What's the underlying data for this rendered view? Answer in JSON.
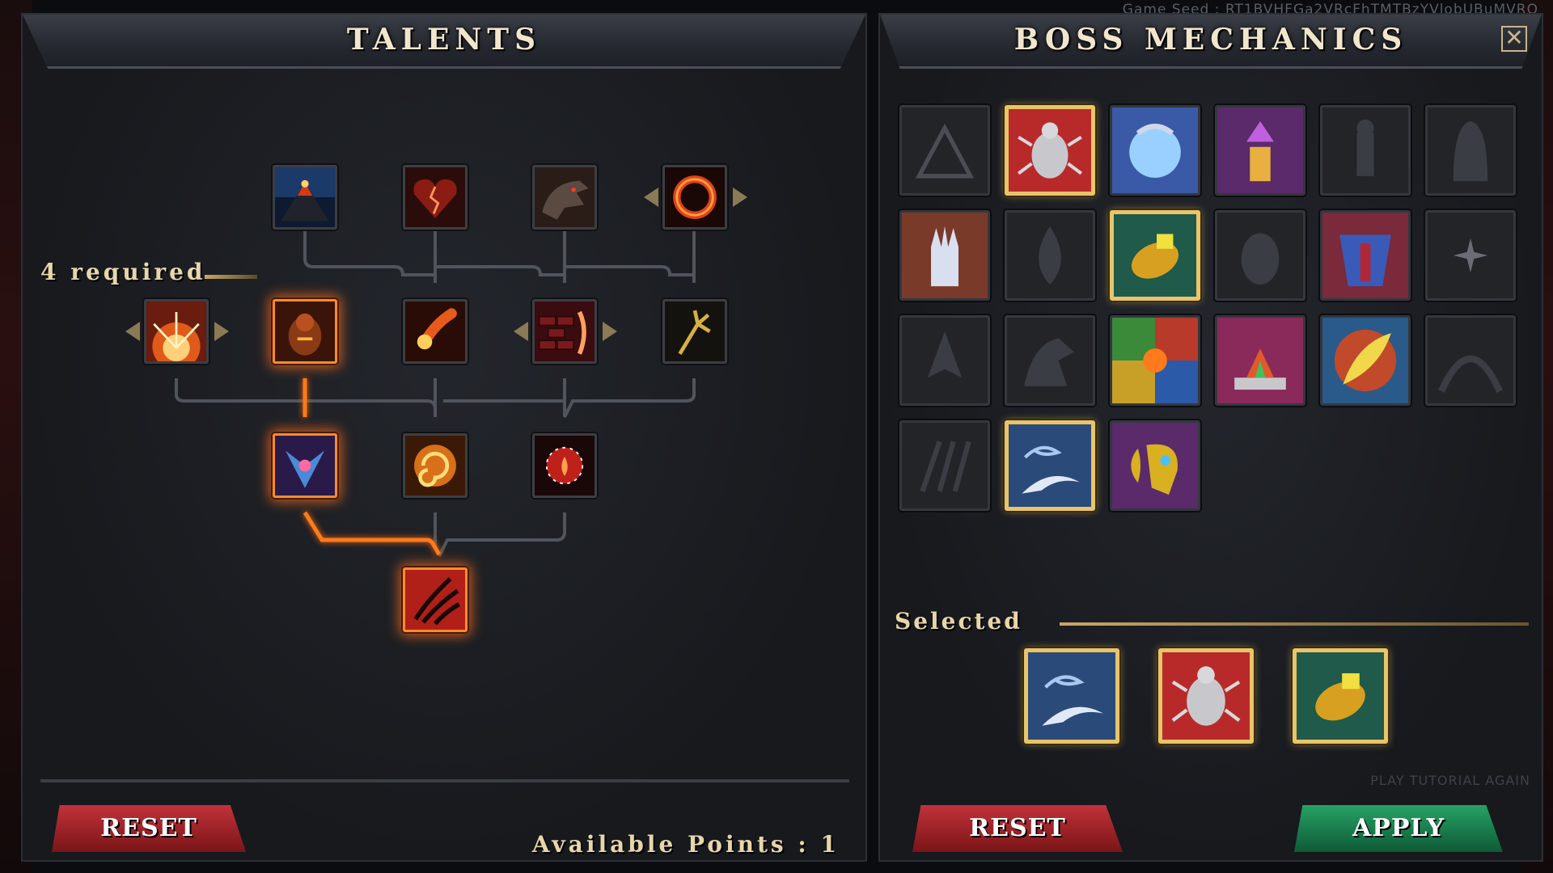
{
  "seed_text": "Game Seed : RT1BVHFGa2VRcFhTMTBzYVlobUBuMVRO",
  "talents": {
    "title": "TALENTS",
    "required_text": "4 required",
    "reset_label": "RESET",
    "available_points": "Available Points : 1",
    "rows": [
      {
        "tier": 1,
        "icons": [
          "volcano-icon",
          "cracked-heart-icon",
          "dragon-head-icon",
          "fire-ring-icon"
        ]
      },
      {
        "tier": 2,
        "icons": [
          "sunburst-icon",
          "fire-golem-icon",
          "fireball-icon",
          "flame-wall-icon",
          "golden-trident-icon"
        ]
      },
      {
        "tier": 3,
        "icons": [
          "phoenix-icon",
          "fire-vortex-icon",
          "burning-sphere-icon"
        ]
      },
      {
        "tier": 4,
        "icons": [
          "blood-claw-icon"
        ]
      }
    ],
    "active_path": [
      "fire-golem-icon",
      "phoenix-icon",
      "blood-claw-icon"
    ]
  },
  "boss": {
    "title": "BOSS MECHANICS",
    "selected_label": "Selected",
    "reset_label": "RESET",
    "apply_label": "APPLY",
    "tutorial_text": "PLAY TUTORIAL AGAIN",
    "mechanics": [
      {
        "icon": "pyramid-icon",
        "state": "locked"
      },
      {
        "icon": "scarab-icon",
        "state": "selected"
      },
      {
        "icon": "moon-orb-icon",
        "state": "available"
      },
      {
        "icon": "pillar-crystal-icon",
        "state": "available"
      },
      {
        "icon": "statue-icon",
        "state": "locked"
      },
      {
        "icon": "hooded-figure-icon",
        "state": "locked"
      },
      {
        "icon": "gauntlet-icon",
        "state": "available"
      },
      {
        "icon": "water-drop-icon",
        "state": "locked"
      },
      {
        "icon": "golden-bracer-icon",
        "state": "selected"
      },
      {
        "icon": "egg-icon",
        "state": "locked"
      },
      {
        "icon": "armor-icon",
        "state": "available"
      },
      {
        "icon": "dark-star-icon",
        "state": "locked"
      },
      {
        "icon": "arrowhead-icon",
        "state": "locked"
      },
      {
        "icon": "creature-icon",
        "state": "locked"
      },
      {
        "icon": "elements-icon",
        "state": "available"
      },
      {
        "icon": "crystal-altar-icon",
        "state": "available"
      },
      {
        "icon": "feather-icon",
        "state": "available"
      },
      {
        "icon": "cave-icon",
        "state": "locked"
      },
      {
        "icon": "claw-marks-icon",
        "state": "locked"
      },
      {
        "icon": "storm-wing-icon",
        "state": "selected"
      },
      {
        "icon": "ram-skull-icon",
        "state": "available"
      }
    ],
    "selected": [
      "storm-wing-icon",
      "scarab-icon",
      "golden-bracer-icon"
    ]
  },
  "colors": {
    "glow": "#ff8a2a",
    "gold": "#e9c46a",
    "reset": "#c2323a",
    "apply": "#27a266"
  }
}
